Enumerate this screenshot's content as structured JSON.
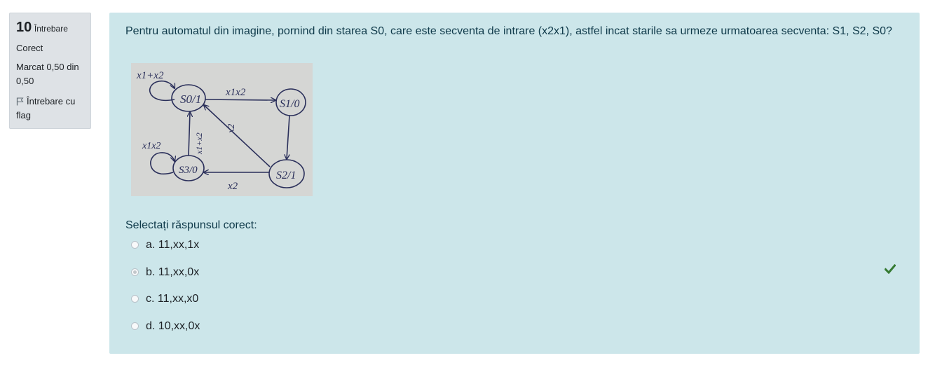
{
  "question_info": {
    "number": "10",
    "number_label": "Întrebare",
    "status": "Corect",
    "mark": "Marcat 0,50 din 0,50",
    "flag_label": "Întrebare cu flag",
    "flag_icon": "flag-outline-icon"
  },
  "question": {
    "text": "Pentru automatul din imagine, pornind din starea S0, care este secventa de intrare (x2x1), astfel incat starile sa urmeze urmatoarea secventa: S1, S2, S0?",
    "prompt": "Selectați răspunsul corect:",
    "diagram": {
      "states": [
        "S0/1",
        "S1/0",
        "S2/1",
        "S3/0"
      ],
      "transition_labels": [
        "x1+x2",
        "x1x2",
        "x2",
        "x1x2",
        "x1+x2",
        "x2"
      ]
    },
    "answers": [
      {
        "label": "a. 11,xx,1x",
        "selected": false
      },
      {
        "label": "b. 11,xx,0x",
        "selected": true
      },
      {
        "label": "c. 11,xx,x0",
        "selected": false
      },
      {
        "label": "d. 10,xx,0x",
        "selected": false
      }
    ],
    "correct_icon": "checkmark-icon",
    "colors": {
      "panel": "#cce6ea",
      "info_panel": "#dee2e6",
      "correct": "#357a32"
    }
  }
}
